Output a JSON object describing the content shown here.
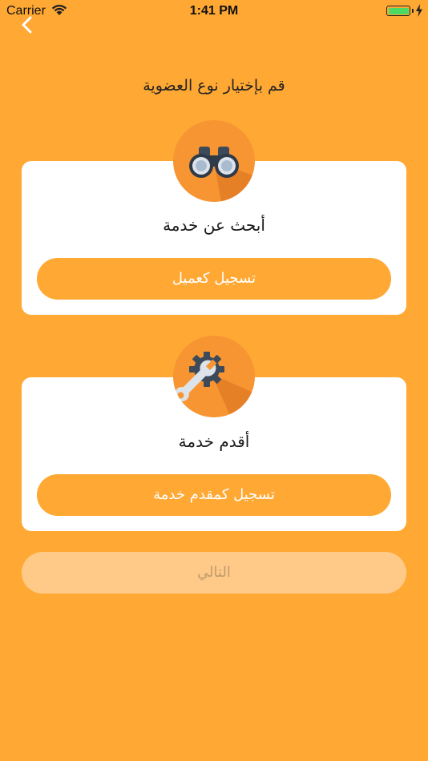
{
  "status_bar": {
    "carrier": "Carrier",
    "time": "1:41 PM",
    "battery_level": 1.0
  },
  "page": {
    "title": "قم بإختيار نوع العضوية"
  },
  "cards": [
    {
      "icon": "binoculars-icon",
      "label": "أبحث عن خدمة",
      "button_label": "تسجيل كعميل"
    },
    {
      "icon": "wrench-gear-icon",
      "label": "أقدم خدمة",
      "button_label": "تسجيل كمقدم خدمة"
    }
  ],
  "next_button": {
    "label": "التالي",
    "enabled": false
  },
  "colors": {
    "background": "#FFA834",
    "card": "#FFFFFF",
    "icon_circle": "#F79533",
    "next_disabled": "#FFCA88",
    "next_text": "#BF9A6C"
  }
}
